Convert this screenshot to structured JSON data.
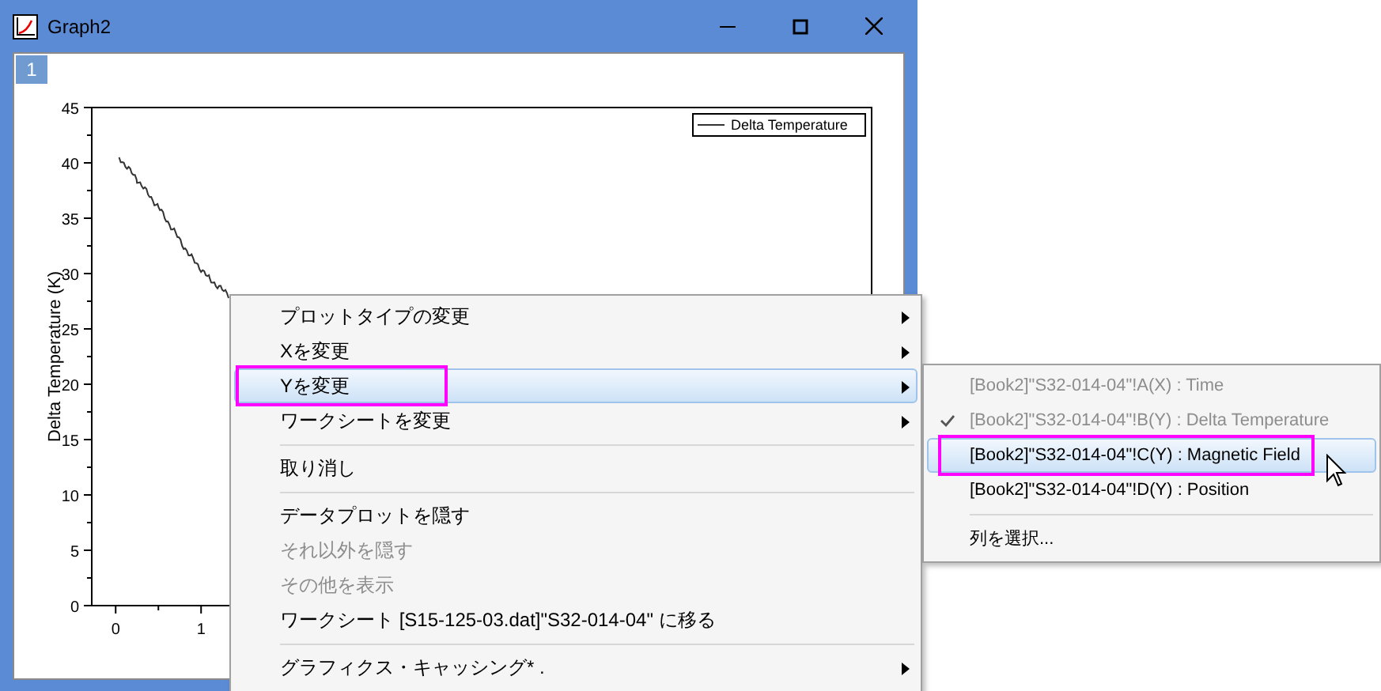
{
  "window": {
    "title": "Graph2",
    "page_tab": "1"
  },
  "graph": {
    "chart_data": {
      "type": "line",
      "ylabel": "Delta Temperature (K)",
      "x": [
        0.04,
        0.25,
        0.5,
        0.87,
        1.1,
        1.33
      ],
      "series": [
        {
          "name": "Delta Temperature",
          "color": "#333333",
          "values": [
            40.5,
            38.5,
            36,
            31.6,
            29.5,
            28
          ]
        }
      ],
      "xlim": [
        -0.28,
        8.85
      ],
      "ylim": [
        0,
        45
      ],
      "xticks": [
        0,
        1
      ],
      "yticks": [
        0,
        5,
        10,
        15,
        20,
        25,
        30,
        35,
        40,
        45
      ]
    }
  },
  "context_menu": {
    "items": [
      {
        "kind": "item",
        "label": "プロットタイプの変更",
        "submenu": true,
        "disabled": false,
        "selected": false,
        "annotated": false
      },
      {
        "kind": "item",
        "label": "Xを変更",
        "submenu": true,
        "disabled": false,
        "selected": false,
        "annotated": false
      },
      {
        "kind": "item",
        "label": "Yを変更",
        "submenu": true,
        "disabled": false,
        "selected": true,
        "annotated": true
      },
      {
        "kind": "item",
        "label": "ワークシートを変更",
        "submenu": true,
        "disabled": false,
        "selected": false,
        "annotated": false
      },
      {
        "kind": "separator"
      },
      {
        "kind": "item",
        "label": "取り消し",
        "submenu": false,
        "disabled": false,
        "selected": false,
        "annotated": false
      },
      {
        "kind": "separator"
      },
      {
        "kind": "item",
        "label": "データプロットを隠す",
        "submenu": false,
        "disabled": false,
        "selected": false,
        "annotated": false
      },
      {
        "kind": "item",
        "label": "それ以外を隠す",
        "submenu": false,
        "disabled": true,
        "selected": false,
        "annotated": false
      },
      {
        "kind": "item",
        "label": "その他を表示",
        "submenu": false,
        "disabled": true,
        "selected": false,
        "annotated": false
      },
      {
        "kind": "item",
        "label": "ワークシート [S15-125-03.dat]\"S32-014-04\" に移る",
        "submenu": false,
        "disabled": false,
        "selected": false,
        "annotated": false
      },
      {
        "kind": "separator"
      },
      {
        "kind": "item",
        "label": "グラフィクス・キャッシング* .",
        "submenu": true,
        "disabled": false,
        "selected": false,
        "annotated": false
      }
    ]
  },
  "submenu": {
    "items": [
      {
        "kind": "item",
        "label": "[Book2]\"S32-014-04\"!A(X) : Time",
        "checked": false,
        "disabled": true,
        "selected": false,
        "annotated": false
      },
      {
        "kind": "item",
        "label": "[Book2]\"S32-014-04\"!B(Y) : Delta Temperature",
        "checked": true,
        "disabled": true,
        "selected": false,
        "annotated": false
      },
      {
        "kind": "item",
        "label": "[Book2]\"S32-014-04\"!C(Y) : Magnetic Field",
        "checked": false,
        "disabled": false,
        "selected": true,
        "annotated": true
      },
      {
        "kind": "item",
        "label": "[Book2]\"S32-014-04\"!D(Y) : Position",
        "checked": false,
        "disabled": false,
        "selected": false,
        "annotated": false
      },
      {
        "kind": "separator"
      },
      {
        "kind": "item",
        "label": "列を選択...",
        "checked": false,
        "disabled": false,
        "selected": false,
        "annotated": false
      }
    ]
  }
}
